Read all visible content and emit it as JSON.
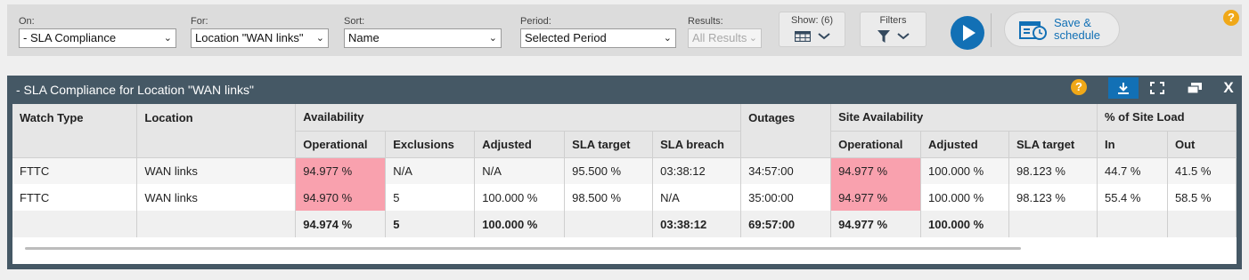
{
  "toolbar": {
    "on": {
      "label": "On:",
      "value": "- SLA Compliance"
    },
    "for": {
      "label": "For:",
      "value": "Location \"WAN links\""
    },
    "sort": {
      "label": "Sort:",
      "value": "Name"
    },
    "period": {
      "label": "Period:",
      "value": "Selected Period"
    },
    "results": {
      "label": "Results:",
      "value": "All Results"
    },
    "show": {
      "label": "Show: (6)",
      "icon": "table-icon"
    },
    "filters": {
      "label": "Filters",
      "icon": "funnel-icon"
    },
    "run_icon": "play-icon",
    "save_label_1": "Save &",
    "save_label_2": "schedule",
    "help_label": "?"
  },
  "panel": {
    "title": "- SLA Compliance for Location \"WAN links\"",
    "help_label": "?",
    "close_label": "X"
  },
  "table": {
    "headers": {
      "watch_type": "Watch Type",
      "location": "Location",
      "availability": "Availability",
      "outages": "Outages",
      "site_availability": "Site Availability",
      "site_load": "% of Site Load",
      "av_operational": "Operational",
      "av_exclusions": "Exclusions",
      "av_adjusted": "Adjusted",
      "av_sla_target": "SLA target",
      "av_sla_breach": "SLA breach",
      "sa_operational": "Operational",
      "sa_adjusted": "Adjusted",
      "sa_sla_target": "SLA target",
      "load_in": "In",
      "load_out": "Out"
    },
    "rows": [
      {
        "watch_type": "FTTC",
        "location": "WAN links",
        "av_operational": "94.977 %",
        "av_exclusions": "N/A",
        "av_adjusted": "N/A",
        "av_sla_target": "95.500 %",
        "av_sla_breach": "03:38:12",
        "outages": "34:57:00",
        "sa_operational": "94.977 %",
        "sa_adjusted": "100.000 %",
        "sa_sla_target": "98.123 %",
        "load_in": "44.7 %",
        "load_out": "41.5 %"
      },
      {
        "watch_type": "FTTC",
        "location": "WAN links",
        "av_operational": "94.970 %",
        "av_exclusions": "5",
        "av_adjusted": "100.000 %",
        "av_sla_target": "98.500 %",
        "av_sla_breach": "N/A",
        "outages": "35:00:00",
        "sa_operational": "94.977 %",
        "sa_adjusted": "100.000 %",
        "sa_sla_target": "98.123 %",
        "load_in": "55.4 %",
        "load_out": "58.5 %"
      }
    ],
    "totals": {
      "av_operational": "94.974 %",
      "av_exclusions": "5",
      "av_adjusted": "100.000 %",
      "av_sla_breach": "03:38:12",
      "outages": "69:57:00",
      "sa_operational": "94.977 %",
      "sa_adjusted": "100.000 %"
    }
  },
  "colors": {
    "breach": "#f9a1ae",
    "accent": "#1270b5",
    "panel_header": "#455865",
    "help": "#f0a818"
  }
}
